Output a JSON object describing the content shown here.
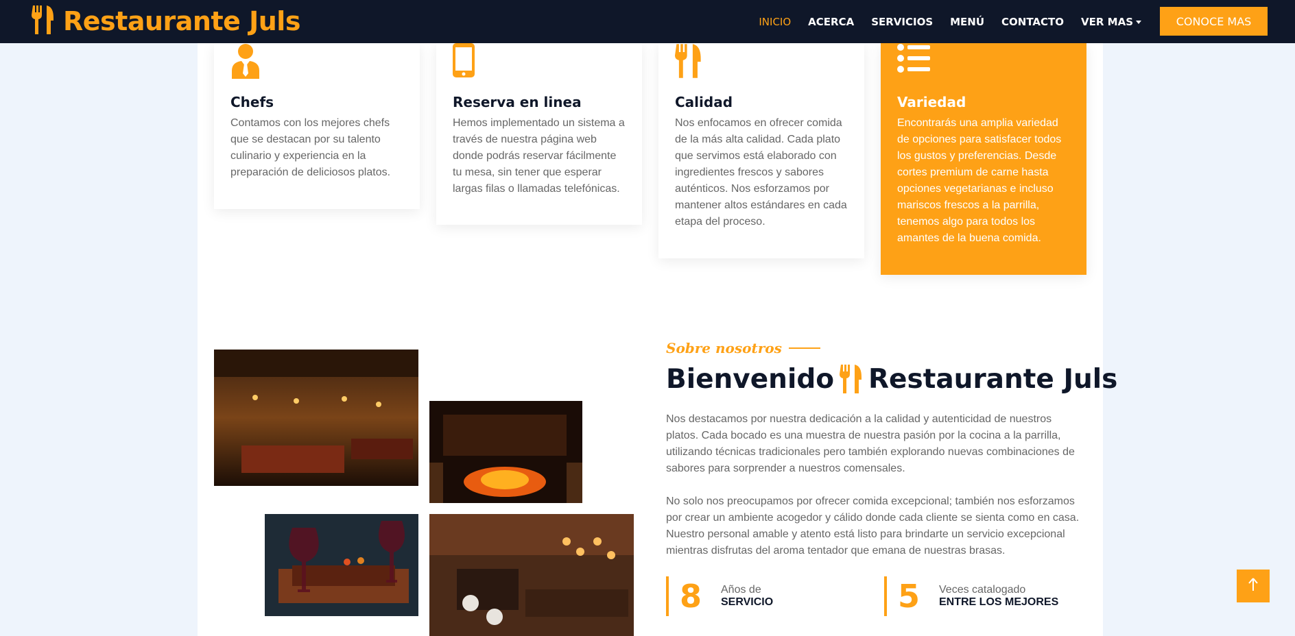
{
  "brand": {
    "name": "Restaurante Juls"
  },
  "nav": {
    "items": [
      "INICIO",
      "ACERCA",
      "SERVICIOS",
      "MENÚ",
      "CONTACTO",
      "VER MAS"
    ],
    "cta": "CONOCE MAS"
  },
  "services": [
    {
      "title": "Chefs",
      "text": "Contamos con los mejores chefs que se destacan por su talento culinario y experiencia en la preparación de deliciosos platos.",
      "icon": "chef-icon"
    },
    {
      "title": "Reserva en linea",
      "text": "Hemos implementado un sistema a través de nuestra página web donde podrás reservar fácilmente tu mesa, sin tener que esperar largas filas o llamadas telefónicas.",
      "icon": "mobile-phone-icon"
    },
    {
      "title": "Calidad",
      "text": "Nos enfocamos en ofrecer comida de la más alta calidad. Cada plato que servimos está elaborado con ingredientes frescos y sabores auténticos. Nos esforzamos por mantener altos estándares en cada etapa del proceso.",
      "icon": "utensils-icon"
    },
    {
      "title": "Variedad",
      "text": "Encontrarás una amplia variedad de opciones para satisfacer todos los gustos y preferencias. Desde cortes premium de carne hasta opciones vegetarianas e incluso mariscos frescos a la parrilla, tenemos algo para todos los amantes de la buena comida.",
      "icon": "list-icon"
    }
  ],
  "about": {
    "eyebrow": "Sobre nosotros",
    "title_part1": "Bienvenido",
    "title_part2": "Restaurante Juls",
    "p1": "Nos destacamos por nuestra dedicación a la calidad y autenticidad de nuestros platos. Cada bocado es una muestra de nuestra pasión por la cocina a la parrilla, utilizando técnicas tradicionales pero también explorando nuevas combinaciones de sabores para sorprender a nuestros comensales.",
    "p2": "No solo nos preocupamos por ofrecer comida excepcional; también nos esforzamos por crear un ambiente acogedor y cálido donde cada cliente se sienta como en casa. Nuestro personal amable y atento está listo para brindarte un servicio excepcional mientras disfrutas del aroma tentador que emana de nuestras brasas."
  },
  "stats": [
    {
      "number": "8",
      "line1": "Años de",
      "line2": "SERVICIO"
    },
    {
      "number": "5",
      "line1": "Veces catalogado",
      "line2": "ENTRE LOS MEJORES"
    }
  ],
  "colors": {
    "accent": "#fea116",
    "dark": "#0f1729",
    "page_bg": "#eef4fc"
  }
}
